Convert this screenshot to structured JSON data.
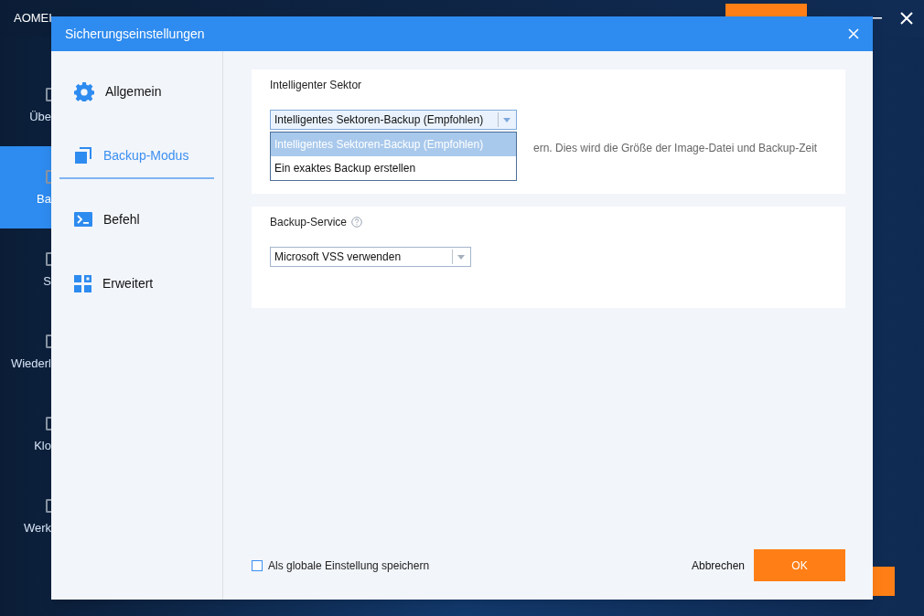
{
  "app": {
    "title": "AOMEI",
    "sidebar": [
      {
        "label": "Übe",
        "selected": false
      },
      {
        "label": "Ba",
        "selected": true
      },
      {
        "label": "S",
        "selected": false
      },
      {
        "label": "Wiederl",
        "selected": false
      },
      {
        "label": "Klo",
        "selected": false
      },
      {
        "label": "Werk",
        "selected": false
      }
    ]
  },
  "dialog": {
    "title": "Sicherungseinstellungen",
    "nav": [
      {
        "label": "Allgemein",
        "kind": "general",
        "selected": false
      },
      {
        "label": "Backup-Modus",
        "kind": "mode",
        "selected": true
      },
      {
        "label": "Befehl",
        "kind": "command",
        "selected": false
      },
      {
        "label": "Erweitert",
        "kind": "advanced",
        "selected": false
      }
    ],
    "sections": [
      {
        "title": "Intelligenter Sektor",
        "help": false,
        "dropdown": {
          "value": "Intelligentes Sektoren-Backup (Empfohlen)",
          "open": true,
          "options": [
            {
              "label": "Intelligentes Sektoren-Backup (Empfohlen)",
              "selected": true
            },
            {
              "label": "Ein exaktes Backup erstellen",
              "selected": false
            }
          ]
        },
        "description": "ern. Dies wird die Größe der Image-Datei und Backup-Zeit"
      },
      {
        "title": "Backup-Service",
        "help": true,
        "dropdown": {
          "value": "Microsoft VSS verwenden",
          "open": false
        }
      }
    ],
    "checkbox": {
      "label": "Als globale Einstellung speichern",
      "checked": false
    },
    "buttons": [
      {
        "label": "Abbrechen",
        "kind": "text"
      },
      {
        "label": "OK",
        "kind": "primary"
      }
    ]
  }
}
